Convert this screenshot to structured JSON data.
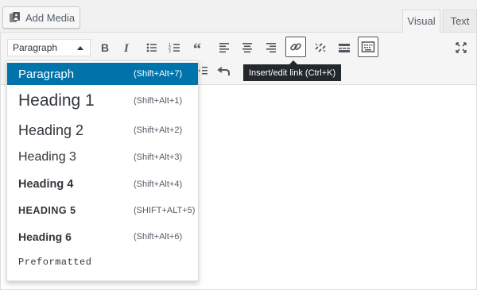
{
  "media": {
    "add_media_label": "Add Media",
    "icon": "add-media-icon"
  },
  "tabs": [
    {
      "label": "Visual",
      "active": true
    },
    {
      "label": "Text",
      "active": false
    }
  ],
  "toolbar": {
    "format_select_value": "Paragraph",
    "row1_buttons": [
      "bold-icon",
      "italic-icon",
      "bulleted-list-icon",
      "numbered-list-icon",
      "blockquote-icon",
      "align-left-icon",
      "align-center-icon",
      "align-right-icon",
      "insert-link-icon",
      "unlink-icon",
      "read-more-icon",
      "toolbar-toggle-icon",
      "fullscreen-icon"
    ],
    "row2_visible_buttons": [
      "indent-icon",
      "undo-icon"
    ]
  },
  "tooltip": {
    "text": "Insert/edit link (Ctrl+K)"
  },
  "format_menu": {
    "items": [
      {
        "label": "Paragraph",
        "shortcut": "(Shift+Alt+7)",
        "selected": true
      },
      {
        "label": "Heading 1",
        "shortcut": "(Shift+Alt+1)"
      },
      {
        "label": "Heading 2",
        "shortcut": "(Shift+Alt+2)"
      },
      {
        "label": "Heading 3",
        "shortcut": "(Shift+Alt+3)"
      },
      {
        "label": "Heading 4",
        "shortcut": "(Shift+Alt+4)"
      },
      {
        "label": "Heading 5",
        "shortcut": "(Shift+Alt+5)"
      },
      {
        "label": "Heading 6",
        "shortcut": "(Shift+Alt+6)"
      },
      {
        "label": "Preformatted",
        "shortcut": ""
      }
    ]
  },
  "colors": {
    "accent": "#0073aa",
    "tooltip_bg": "#23282d",
    "toolbar_bg": "#f5f5f5",
    "border": "#dcdcde"
  }
}
